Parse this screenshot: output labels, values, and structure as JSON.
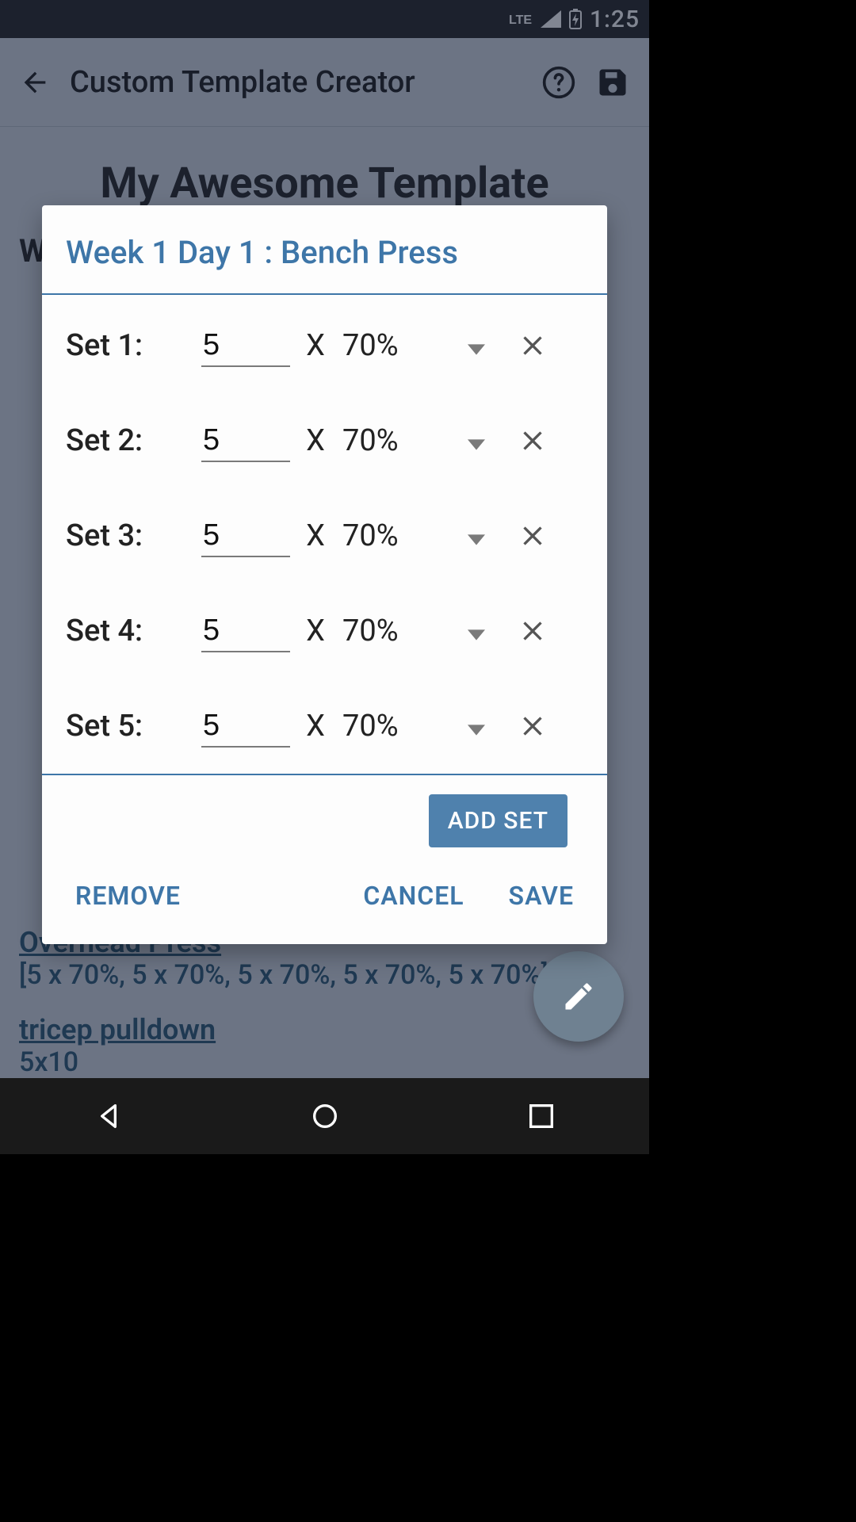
{
  "statusbar": {
    "time": "1:25"
  },
  "appbar": {
    "title": "Custom Template Creator"
  },
  "page": {
    "big_title": "My Awesome Template",
    "week_head_partial": "W",
    "ex1_name": "Overhead Press",
    "ex1_detail": "[5 x 70%, 5 x 70%, 5 x 70%, 5 x 70%, 5 x 70%]",
    "ex2_name": "tricep pulldown",
    "ex2_detail": "5x10"
  },
  "dialog": {
    "title": "Week 1 Day 1 :  Bench Press",
    "addset_label": "ADD SET",
    "remove_label": "REMOVE",
    "cancel_label": "CANCEL",
    "save_label": "SAVE",
    "sets": [
      {
        "label": "Set 1:",
        "reps": "5",
        "x": "X",
        "pct": "70%"
      },
      {
        "label": "Set 2:",
        "reps": "5",
        "x": "X",
        "pct": "70%"
      },
      {
        "label": "Set 3:",
        "reps": "5",
        "x": "X",
        "pct": "70%"
      },
      {
        "label": "Set 4:",
        "reps": "5",
        "x": "X",
        "pct": "70%"
      },
      {
        "label": "Set 5:",
        "reps": "5",
        "x": "X",
        "pct": "70%"
      }
    ]
  }
}
